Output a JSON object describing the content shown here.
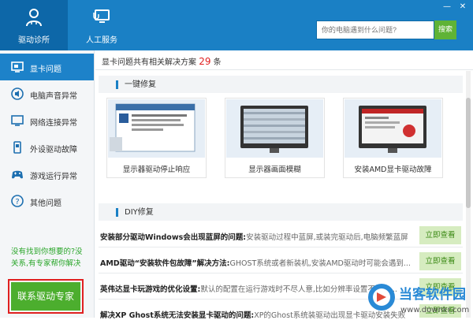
{
  "header": {
    "tabs": [
      {
        "label": "驱动诊所"
      },
      {
        "label": "人工服务"
      }
    ],
    "search": {
      "placeholder": "你的电脑遇到什么问题?",
      "button": "搜索"
    }
  },
  "sidebar": {
    "items": [
      {
        "label": "显卡问题"
      },
      {
        "label": "电脑声音异常"
      },
      {
        "label": "网络连接异常"
      },
      {
        "label": "外设驱动故障"
      },
      {
        "label": "游戏运行异常"
      },
      {
        "label": "其他问题"
      }
    ],
    "hint": "没有找到你想要的?没关系,有专家帮你解决",
    "contact_button": "联系驱动专家"
  },
  "main": {
    "summary_prefix": "显卡问题共有相关解决方案",
    "summary_count": "29",
    "summary_suffix": "条",
    "one_click": {
      "title": "一键修复",
      "cards": [
        {
          "label": "显示器驱动停止响应"
        },
        {
          "label": "显示器画面模糊"
        },
        {
          "label": "安装AMD显卡驱动故障"
        }
      ]
    },
    "diy": {
      "title": "DIY修复",
      "rows": [
        {
          "title": "安装部分驱动Windows会出现蓝屏的问题:",
          "desc": "安装驱动过程中蓝屏,或装完驱动后,电脑频繁蓝屏",
          "button": "立即查看"
        },
        {
          "title": "AMD驱动“安装软件包故障”解决方法:",
          "desc": "GHOST系统或者新装机,安装AMD驱动时可能会遇到...",
          "button": "立即查看"
        },
        {
          "title": "英伟达显卡玩游戏的优化设置:",
          "desc": "默认的配置在运行游戏时不尽人意,比如分辨率设置不正确...",
          "button": "立即查看"
        },
        {
          "title": "解决XP Ghost系统无法安装显卡驱动的问题:",
          "desc": "XP的Ghost系统装驱动出现显卡驱动安装失败",
          "button": "立即查看"
        }
      ]
    }
  },
  "watermark": {
    "name": "当客软件园",
    "url": "www.downkr.com"
  },
  "colors": {
    "header": "#1a80c5",
    "accent_green": "#4cae2e",
    "count_red": "#e02020"
  }
}
